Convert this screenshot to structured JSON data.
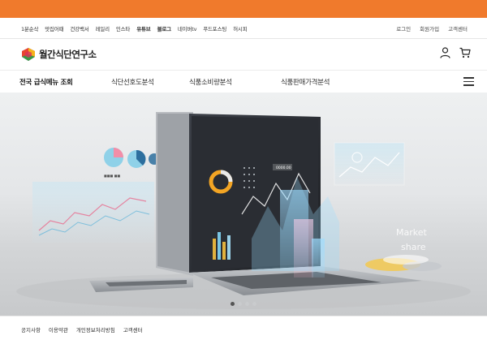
{
  "brand": {
    "name": "월간식단연구소",
    "accent": "#f07a2c"
  },
  "utility_left": [
    "1분순삭",
    "맛집어때",
    "건강백서",
    "레일리",
    "인스타",
    "유튜브",
    "블로그",
    "네이버tv",
    "푸드포스팅",
    "허시피"
  ],
  "utility_right": [
    "로그인",
    "회원가입",
    "고객센터"
  ],
  "nav": [
    "전국 급식메뉴 조회",
    "식단선호도분석",
    "식품소비량분석",
    "식품판매가격분석"
  ],
  "hero": {
    "chart_title": "0000.00",
    "overlay_text": [
      "Market",
      "share"
    ],
    "slides_total": 4,
    "slide_active": 1
  },
  "footer_links": [
    "공지사항",
    "이용약관",
    "개인정보처리방침",
    "고객센터"
  ],
  "icons": [
    "logo-mark-icon",
    "user-icon",
    "cart-icon",
    "hamburger-menu-icon"
  ]
}
